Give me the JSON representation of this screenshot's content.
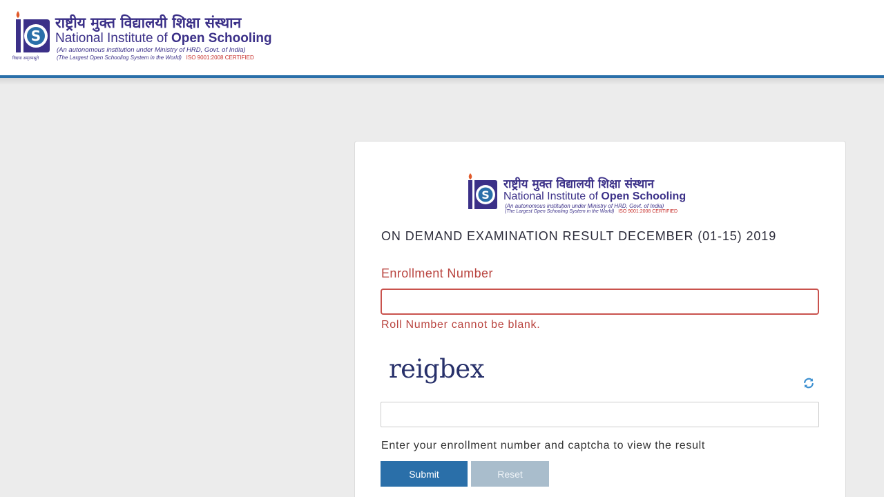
{
  "header": {
    "hindi_name": "राष्ट्रीय मुक्त विद्यालयी शिक्षा संस्थान",
    "name_prefix": "National Institute of ",
    "name_bold": "Open Schooling",
    "subtitle": "(An autonomous institution under  Ministry of HRD, Govt. of India)",
    "tagline": "(The Largest Open Schooling System in the World)",
    "iso": "ISO 9001:2008 CERTIFIED",
    "logo_caption": "विद्यया अमृतमश्नुते"
  },
  "card": {
    "hindi_name": "राष्ट्रीय मुक्त विद्यालयी शिक्षा संस्थान",
    "name_prefix": "National Institute of ",
    "name_bold": "Open Schooling",
    "subtitle": "(An autonomous institution under  Ministry of HRD, Govt. of India)",
    "tagline": "(The Largest Open Schooling System in the World)",
    "iso": "ISO 9001:2008 CERTIFIED",
    "title": "ON DEMAND EXAMINATION RESULT DECEMBER (01-15) 2019"
  },
  "form": {
    "enrollment_label": "Enrollment Number",
    "enrollment_value": "",
    "error": "Roll Number cannot be blank.",
    "captcha_text": "reigbex",
    "captcha_value": "",
    "refresh_icon": "refresh-icon",
    "help": "Enter your enrollment number and captcha to view the result",
    "submit_label": "Submit",
    "reset_label": "Reset"
  },
  "colors": {
    "accent": "#2a6fa9",
    "error": "#b9443f",
    "brand": "#3b3088",
    "iso_red": "#c8302c"
  }
}
